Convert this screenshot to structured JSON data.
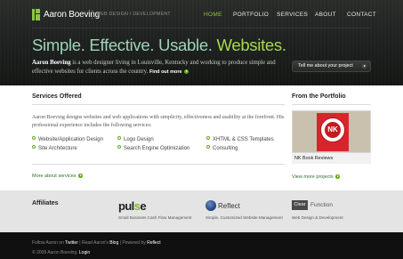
{
  "brand": {
    "name": "Aaron Boeving",
    "tagline": "WEB DESIGN / DEVELOPMENT",
    "accent": "#8cc63f"
  },
  "nav": {
    "items": [
      {
        "label": "HOME",
        "active": true
      },
      {
        "label": "PORTFOLIO",
        "active": false
      },
      {
        "label": "SERVICES",
        "active": false
      },
      {
        "label": "ABOUT",
        "active": false
      },
      {
        "label": "CONTACT",
        "active": false
      }
    ]
  },
  "hero": {
    "title_start": "Simple. Effective. Usable. ",
    "title_end": "Websites.",
    "name": "Aaron Boeving",
    "text": " is a web designer living in Louisville, Kentucky and working to produce simple and effective websites for clients across the country.",
    "link": "Find out more",
    "button": "Tell me about your project"
  },
  "services": {
    "heading": "Services Offered",
    "intro": "Aaron Boeving designs websites and web applications with simplicity, effectiveness and usability at the forefront. His professional experience includes the following services:",
    "items": [
      "Website/Application Design",
      "Logo Design",
      "XHTML & CSS Templates",
      "Site Architecture",
      "Search Engine Optimization",
      "Consulting"
    ],
    "more": "More about services"
  },
  "portfolio": {
    "heading": "From the Portfolio",
    "badge_text": "NK",
    "caption": "NK Book Reviews",
    "more": "View more projects"
  },
  "affiliates": {
    "heading": "Affiliates",
    "items": [
      {
        "logo_a": "pul",
        "logo_b": "s",
        "logo_c": "e",
        "caption": "Small Business Cash Flow Management"
      },
      {
        "logo": "Reflect",
        "caption": "Simple, Customized Website Management"
      },
      {
        "logo_box": "Clear",
        "logo_word": "Function",
        "caption": "Web Design & Development"
      }
    ]
  },
  "footer": {
    "line1_a": "Follow Aaron on ",
    "twitter": "Twitter",
    "sep1": " | Read Aaron's ",
    "blog": "Blog",
    "sep2": " | Powered by ",
    "reflect": "Reflect",
    "line2_a": "© 2009 Aaron Boeving. ",
    "login": "Login"
  }
}
